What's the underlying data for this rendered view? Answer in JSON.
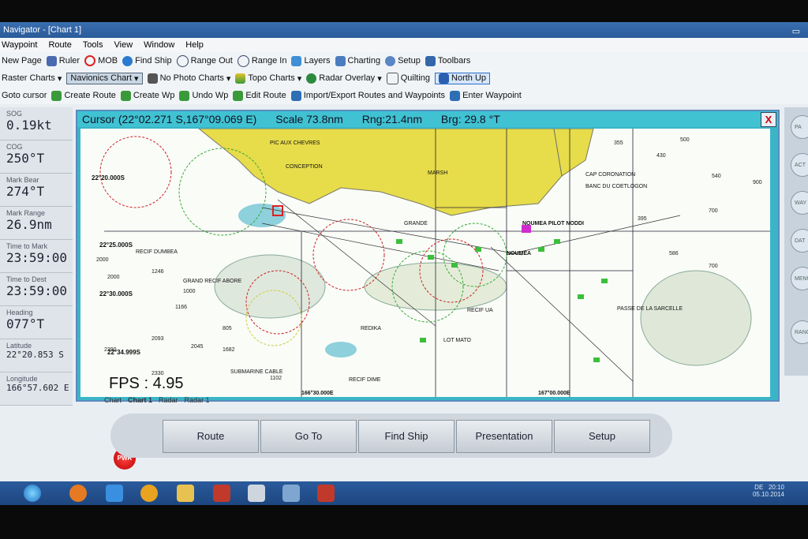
{
  "title": "Navigator - [Chart 1]",
  "menu": [
    "Waypoint",
    "Route",
    "Tools",
    "View",
    "Window",
    "Help"
  ],
  "toolbar1": [
    "New Page",
    "Ruler",
    "MOB",
    "Find Ship",
    "Range Out",
    "Range In",
    "Layers",
    "Charting",
    "Setup",
    "Toolbars"
  ],
  "toolbar2": {
    "raster": "Raster Charts",
    "navionics": "Navionics Chart",
    "photo": "No Photo Charts",
    "topo": "Topo Charts",
    "radar": "Radar Overlay",
    "quilting": "Quilting",
    "northup": "North Up"
  },
  "toolbar3": [
    "Goto cursor",
    "Create Route",
    "Create Wp",
    "Undo Wp",
    "Edit Route",
    "Import/Export Routes and Waypoints",
    "Enter Waypoint"
  ],
  "sidebar": [
    {
      "label": "SOG",
      "value": "0.19kt"
    },
    {
      "label": "COG",
      "value": "250°T"
    },
    {
      "label": "Mark Bear",
      "value": "274°T"
    },
    {
      "label": "Mark Range",
      "value": "26.9nm"
    },
    {
      "label": "Time to Mark",
      "value": "23:59:00"
    },
    {
      "label": "Time to Dest",
      "value": "23:59:00"
    },
    {
      "label": "Heading",
      "value": "077°T"
    },
    {
      "label": "Latitude",
      "value": "22°20.853 S"
    },
    {
      "label": "Longitude",
      "value": "166°57.602 E"
    }
  ],
  "chart_header": {
    "cursor": "Cursor (22°02.271 S,167°09.069 E)",
    "scale": "Scale 73.8nm",
    "rng": "Rng:21.4nm",
    "brg": "Brg: 29.8 °T"
  },
  "close_label": "X",
  "map": {
    "places": [
      "PIC AUX CHEVRES",
      "CONCEPTION",
      "MARSH",
      "CAP CORONATION",
      "BANC DU COETLOGON",
      "NOUMEA PILOT NODDI",
      "NOUMEA",
      "GRANDE",
      "GRAND RECIF ABORE",
      "RECIF DUMBEA",
      "PASSE DE LA SARCELLE",
      "RECIF UA",
      "LOT MATO",
      "RECIF DIME",
      "SUBMARINE CABLE",
      "REDIKA"
    ],
    "latitudes": [
      "22°20.000S",
      "22°25.000S",
      "22°30.000S",
      "22°34.999S"
    ],
    "longitudes": [
      "166°30.000E",
      "167°00.000E"
    ],
    "depths": [
      "355",
      "500",
      "430",
      "540",
      "900",
      "395",
      "700",
      "586",
      "700",
      "2000",
      "2000",
      "1246",
      "1000",
      "1166",
      "2093",
      "2045",
      "2390",
      "2330",
      "1102",
      "805",
      "1682"
    ]
  },
  "fps": "FPS : 4.95",
  "tabs": [
    "Chart",
    "Chart 1",
    "Radar",
    "Radar 1"
  ],
  "rightpanel": [
    "PA",
    "ACT",
    "WAY",
    "DAT",
    "MENU",
    "RANGE"
  ],
  "bottom_buttons": [
    "Route",
    "Go To",
    "Find Ship",
    "Presentation",
    "Setup"
  ],
  "pwr": "PWR",
  "tray": {
    "lang": "DE",
    "time": "20:10",
    "date": "05.10.2014"
  }
}
